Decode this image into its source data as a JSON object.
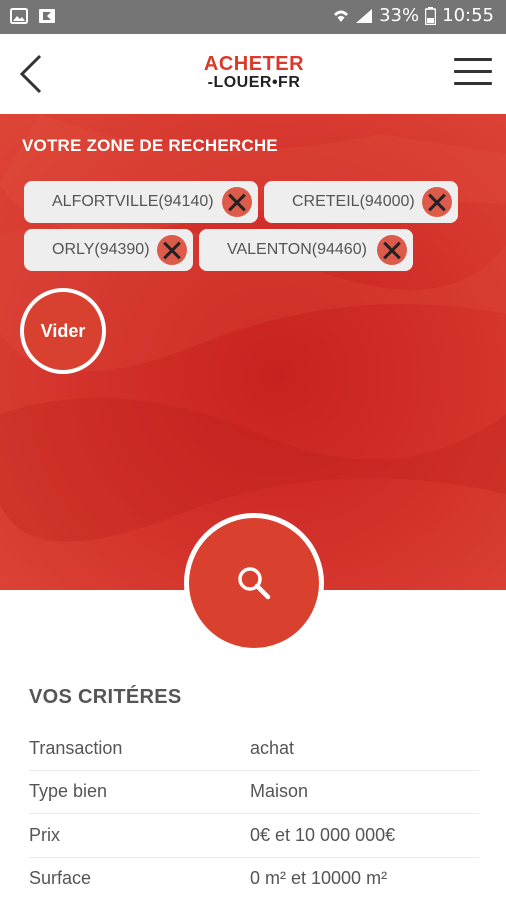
{
  "status_bar": {
    "battery": "33%",
    "time": "10:55",
    "icons": [
      "gallery-icon",
      "flipboard-icon",
      "wifi-icon",
      "signal-icon",
      "battery-icon"
    ]
  },
  "header": {
    "logo_top": "ACHETER",
    "logo_bottom": "-LOUER•FR",
    "brand_color": "#d93a2b"
  },
  "search_zone": {
    "title": "VOTRE ZONE DE RECHERCHE",
    "chips": [
      {
        "label": "ALFORTVILLE(94140)"
      },
      {
        "label": "CRETEIL(94000)"
      },
      {
        "label": "ORLY(94390)"
      },
      {
        "label": "VALENTON(94460)"
      }
    ],
    "clear_label": "Vider",
    "background_color": "#d2302a"
  },
  "criteria": {
    "title": "VOS CRITÉRES",
    "rows": [
      {
        "label": "Transaction",
        "value": "achat"
      },
      {
        "label": "Type bien",
        "value": "Maison"
      },
      {
        "label": "Prix",
        "value": "0€ et 10 000 000€"
      },
      {
        "label": "Surface",
        "value": "0 m² et 10000 m²"
      }
    ]
  }
}
